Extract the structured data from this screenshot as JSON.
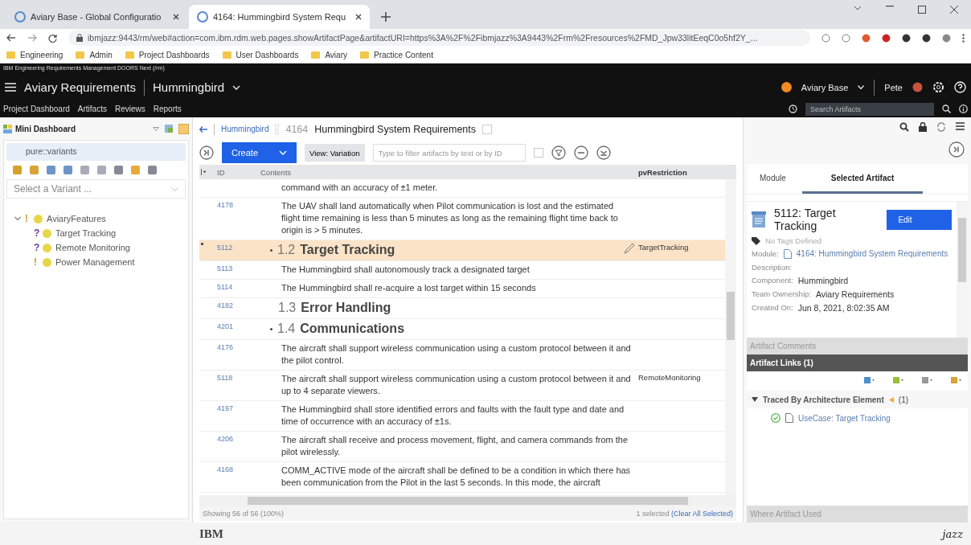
{
  "browser": {
    "tabs": [
      {
        "title": "Aviary Base - Global Configuratio",
        "selected": false
      },
      {
        "title": "4164: Hummingbird System Requ",
        "selected": true
      }
    ],
    "url": "ibmjazz:9443/rm/web#action=com.ibm.rdm.web.pages.showArtifactPage&artifactURI=https%3A%2F%2Fibmjazz%3A9443%2Frm%2Fresources%2FMD_Jpw33litEeqC0o5hf2Y_...",
    "bookmarks": [
      "Engineering",
      "Admin",
      "Project Dashboards",
      "User Dashboards",
      "Aviary",
      "Practice Content"
    ]
  },
  "app": {
    "product": "IBM Engineering Requirements Management DOORS Next (/rm)",
    "project": "Aviary Requirements",
    "component": "Hummingbird",
    "config": "Aviary Base",
    "user": "Pete",
    "nav": [
      "Project Dashboard",
      "Artifacts",
      "Reviews",
      "Reports"
    ],
    "search": {
      "placeholder": "Search Artifacts"
    }
  },
  "mini_dashboard": {
    "title": "Mini Dashboard",
    "widget": "pure::variants",
    "variant_select": {
      "placeholder": "Select a Variant ..."
    },
    "tree": [
      {
        "label": "AviaryFeatures",
        "mark": "!",
        "expanded": true,
        "children": [
          {
            "label": "Target Tracking",
            "mark": "?"
          },
          {
            "label": "Remote Monitoring",
            "mark": "?"
          },
          {
            "label": "Power Management",
            "mark": "!"
          }
        ]
      }
    ]
  },
  "module": {
    "breadcrumb": "Hummingbird",
    "id": "4164",
    "title": "Hummingbird System Requirements",
    "create": "Create",
    "view": "View: Variation",
    "filter": {
      "placeholder": "Type to filter artifacts by text or by ID"
    },
    "columns": [
      "ID",
      "Contents",
      "pvRestriction"
    ],
    "rows": [
      {
        "kind": "text",
        "id": "",
        "text": "command with an accuracy of ±1 meter.",
        "restriction": "",
        "selected": false
      },
      {
        "kind": "text",
        "id": "4178",
        "text": "The UAV shall land automatically when Pilot communication is lost and the estimated flight time remaining is less than 5 minutes as long as the remaining flight time back to origin is > 5 minutes.",
        "restriction": "",
        "selected": false
      },
      {
        "kind": "heading",
        "id": "5112",
        "number": "1.2",
        "text": "Target Tracking",
        "expanded": true,
        "restriction": "TargetTracking",
        "selected": true
      },
      {
        "kind": "text",
        "id": "5113",
        "text": "The Hummingbird shall autonomously track a designated target",
        "restriction": "",
        "selected": false
      },
      {
        "kind": "text",
        "id": "5114",
        "text": "The Hummingbird shall re-acquire a lost target within 15 seconds",
        "restriction": "",
        "selected": false
      },
      {
        "kind": "heading",
        "id": "4182",
        "number": "1.3",
        "text": "Error Handling",
        "expanded": false,
        "restriction": "",
        "selected": false
      },
      {
        "kind": "heading",
        "id": "4201",
        "number": "1.4",
        "text": "Communications",
        "expanded": true,
        "restriction": "",
        "selected": false
      },
      {
        "kind": "text",
        "id": "4176",
        "text": "The aircraft shall support wireless communication using a custom protocol between it and the pilot control.",
        "restriction": "",
        "selected": false
      },
      {
        "kind": "text",
        "id": "5118",
        "text": "The aircraft shall support wireless communication using a custom protocol between it and up to 4 separate viewers.",
        "restriction": "RemoteMonitoring",
        "selected": false
      },
      {
        "kind": "text",
        "id": "4197",
        "text": "The Hummingbird shall store identified errors and faults with the fault type and date and time of occurrence with an accuracy of ±1s.",
        "restriction": "",
        "selected": false
      },
      {
        "kind": "text",
        "id": "4206",
        "text": "The aircraft shall receive and process movement, flight, and camera commands from the pilot wirelessly.",
        "restriction": "",
        "selected": false
      },
      {
        "kind": "text",
        "id": "4168",
        "text": "COMM_ACTIVE mode of the aircraft shall be defined to be a condition in which there has been communication from the Pilot in the last 5 seconds. In this mode, the aircraft",
        "restriction": "",
        "selected": false
      }
    ],
    "status": "Showing 56 of 56 (100%)",
    "selection": "1 selected",
    "clear": "(Clear All Selected)"
  },
  "details": {
    "tabs": [
      {
        "label": "Module",
        "selected": false
      },
      {
        "label": "Selected Artifact",
        "selected": true
      }
    ],
    "artifact": {
      "title": "5112: Target Tracking",
      "edit": "Edit",
      "tags": "No Tags Defined",
      "fields": [
        {
          "kind": "link",
          "label": "Module:",
          "value": "4164: Hummingbird System Requirements"
        },
        {
          "kind": "text",
          "label": "Description:"
        },
        {
          "kind": "text",
          "label": "Component:",
          "value": "Hummingbird"
        },
        {
          "kind": "text",
          "label": "Team Ownership:",
          "value": "Aviary Requirements"
        },
        {
          "kind": "text",
          "label": "Created On:",
          "value": "Jun 8, 2021, 8:02:35 AM"
        }
      ]
    },
    "sections": [
      {
        "title": "Artifact Comments",
        "expanded": false
      },
      {
        "title": "Artifact Links (1)",
        "expanded": true
      },
      {
        "title": "Where Artifact Used",
        "expanded": false
      }
    ],
    "links": {
      "group": "Traced By Architecture Element",
      "count": "(1)",
      "expanded": true,
      "items": [
        {
          "label": "UseCase: Target Tracking"
        }
      ]
    }
  },
  "footer": {
    "brand": "IBM",
    "logo": "jazz"
  }
}
